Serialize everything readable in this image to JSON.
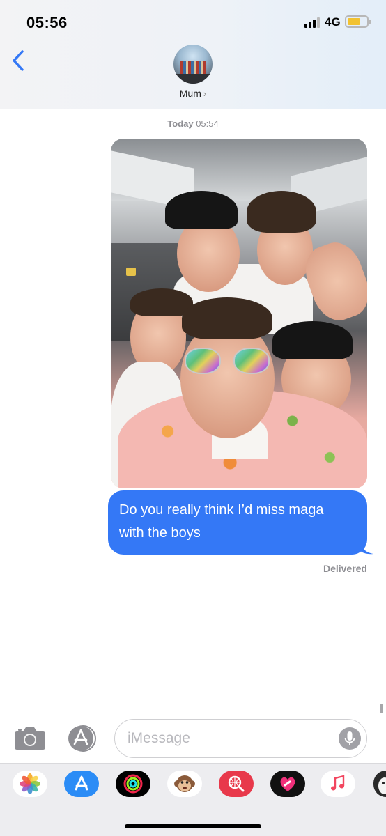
{
  "status_bar": {
    "time": "05:56",
    "network": "4G",
    "battery_color": "#f2c230"
  },
  "header": {
    "contact_name": "Mum",
    "chevron": "›",
    "back_icon": "chevron-left-icon"
  },
  "conversation": {
    "timestamp_day": "Today",
    "timestamp_time": "05:54",
    "messages": [
      {
        "type": "image",
        "sender": "me"
      },
      {
        "type": "text",
        "sender": "me",
        "lines": [
          "Do you really think I’d miss maga",
          "with the boys"
        ]
      }
    ],
    "status": "Delivered"
  },
  "composer": {
    "placeholder": "iMessage",
    "camera_icon": "camera-icon",
    "apps_icon": "app-store-icon",
    "mic_icon": "microphone-icon"
  },
  "app_drawer": {
    "apps": [
      "Photos",
      "App Store",
      "Activity",
      "Animoji",
      "Web Search",
      "Digital Touch",
      "Music",
      "Sticker"
    ]
  },
  "colors": {
    "bubble": "#3478f6",
    "accent": "#3478f6"
  }
}
